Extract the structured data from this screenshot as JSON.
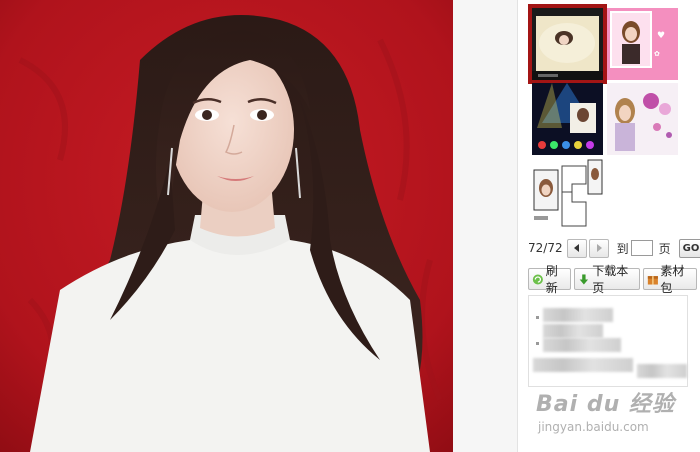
{
  "viewer": {
    "main_image_alt": "portrait photo"
  },
  "thumbnails": [
    {
      "id": "thumb-1"
    },
    {
      "id": "thumb-2"
    },
    {
      "id": "thumb-3"
    },
    {
      "id": "thumb-4"
    },
    {
      "id": "thumb-5"
    }
  ],
  "pager": {
    "count": "72/72",
    "goto_label": "到",
    "page_label": "页",
    "page_input_value": "",
    "go_label": "GO"
  },
  "actions": {
    "refresh": "刷新",
    "download": "下载本页",
    "package": "素材包"
  },
  "watermark": {
    "main": "Bai du 经验",
    "sub": "jingyan.baidu.com"
  },
  "colors": {
    "selected_border": "#a31515",
    "background_red": "#b2151e"
  }
}
